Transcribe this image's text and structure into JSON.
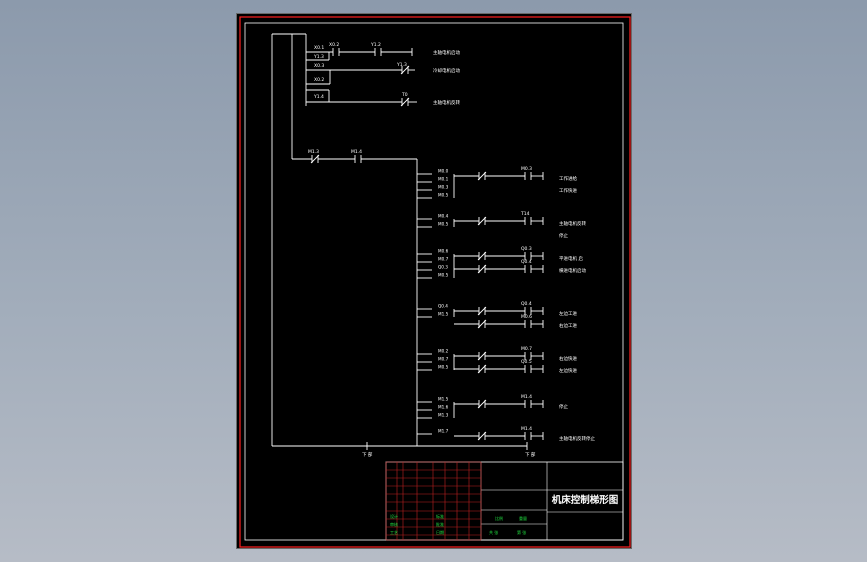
{
  "colors": {
    "background_top": "#8c9aac",
    "background_bottom": "#b6bcc6",
    "sheet": "#000000",
    "border": "#ff2020",
    "wire": "#ffffff",
    "label_text": "#ffffff",
    "title_text": "#ffffff",
    "grid_line": "#c02020",
    "field_text": "#20e040"
  },
  "top_rungs": [
    {
      "contacts": [
        "X0.1",
        "Y1.3",
        "X0.2"
      ],
      "coil": "Y1.2",
      "note": "主轴电机启动"
    },
    {
      "contacts": [
        "X0.3",
        "X0.2"
      ],
      "coil": "Y1.3",
      "note": "冷却电机启动"
    },
    {
      "contacts": [
        "Y1.4"
      ],
      "coil": "T0",
      "note": "主轴电机反转"
    }
  ],
  "main_contacts": [
    "M1.3",
    "M1.4"
  ],
  "branch_groups": [
    {
      "contacts": [
        "M0.0",
        "M0.1",
        "M0.3",
        "M0.5"
      ],
      "coils": [
        "M0.3"
      ],
      "notes": [
        "工作进给",
        "工作快进"
      ]
    },
    {
      "contacts": [
        "M0.4",
        "M0.5"
      ],
      "coils": [
        "T14"
      ],
      "notes": [
        "主轴电机反转",
        "停止"
      ]
    },
    {
      "contacts": [
        "M0.6",
        "M0.7",
        "Q0.3",
        "M0.5"
      ],
      "coils": [
        "Q0.3",
        "Q0.4"
      ],
      "notes": [
        "平进电机 启",
        "横进电机启动"
      ]
    },
    {
      "contacts": [
        "Q0.4",
        "M1.5"
      ],
      "coils": [
        "Q0.4",
        "M0.6"
      ],
      "notes": [
        "左边工进",
        "右边工进"
      ]
    },
    {
      "contacts": [
        "M0.2",
        "M0.7",
        "M0.5"
      ],
      "coils": [
        "M0.7",
        "Q0.5"
      ],
      "notes": [
        "右边快进",
        "左边快进"
      ]
    },
    {
      "contacts": [
        "M1.5",
        "M1.6",
        "M1.3"
      ],
      "coils": [
        "M1.4"
      ],
      "notes": [
        "停止"
      ]
    },
    {
      "contacts": [
        "M1.7"
      ],
      "coils": [
        "M1.4"
      ],
      "notes": [
        "主轴电机反转停止"
      ]
    }
  ],
  "bottom_labels": [
    "下 部",
    "下 部"
  ],
  "title_block": {
    "title": "机床控制梯形图",
    "small_cells": [
      "设计",
      "审核",
      "工艺",
      "标准",
      "批准",
      "日期",
      "比例",
      "重量",
      "共 张",
      "第 张"
    ]
  }
}
